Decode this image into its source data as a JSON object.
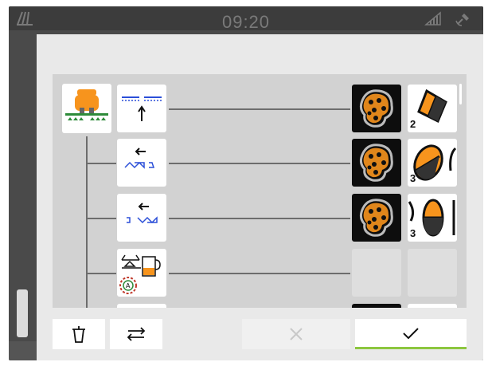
{
  "statusbar": {
    "time": "09:20",
    "left_icon": "fields-icon",
    "sat_icon": "signal-strength-icon",
    "gps_icon": "gps-satellite-icon"
  },
  "background": {
    "page_dots": "•••••"
  },
  "dialog": {
    "root": {
      "icon": "sprayer-machine-icon"
    },
    "rows": [
      {
        "function_icon": "boom-fold-icon",
        "map_icon": "field-map-icon",
        "section_icon": "section-2-icon",
        "section_count": "2"
      },
      {
        "function_icon": "section-control-left-icon",
        "map_icon": "field-map-icon",
        "section_icon": "section-3a-icon",
        "section_count": "3"
      },
      {
        "function_icon": "section-control-right-icon",
        "map_icon": "field-map-icon",
        "section_icon": "section-3b-icon",
        "section_count": "3"
      },
      {
        "function_icon": "tank-rate-control-icon",
        "map_icon": "empty-slot",
        "section_icon": "empty-slot"
      }
    ],
    "footer": {
      "delete_icon": "trash-icon",
      "swap_icon": "swap-arrows-icon",
      "cancel_icon": "close-x-icon",
      "confirm_icon": "checkmark-icon"
    }
  },
  "colors": {
    "accent_orange": "#f7941d",
    "confirm_green": "#8cc63f",
    "device_blue": "#2b4fd8"
  }
}
